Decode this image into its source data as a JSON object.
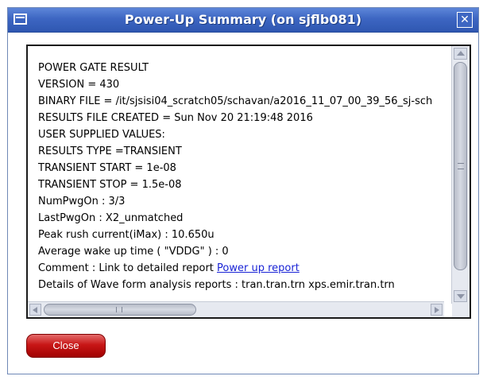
{
  "window": {
    "title": "Power-Up Summary (on sjflb081)",
    "close_glyph": "✕"
  },
  "report": {
    "lines": [
      "POWER GATE RESULT",
      "VERSION = 430",
      "BINARY FILE = /it/sjsisi04_scratch05/schavan/a2016_11_07_00_39_56_sj-sch",
      "RESULTS FILE CREATED = Sun Nov 20 21:19:48 2016",
      "USER SUPPLIED VALUES:",
      "RESULTS TYPE =TRANSIENT",
      "TRANSIENT START = 1e-08",
      "TRANSIENT STOP = 1.5e-08",
      "NumPwgOn : 3/3",
      "LastPwgOn : X2_unmatched",
      "Peak rush current(iMax) : 10.650u",
      "Average wake up time ( \"VDDG\" ) : 0"
    ],
    "comment_prefix": "Comment : Link to detailed report ",
    "comment_link": "Power up report",
    "details": "Details of Wave form analysis reports : tran.tran.trn xps.emir.tran.trn"
  },
  "buttons": {
    "close_label": "Close"
  },
  "colors": {
    "titlebar": "#3d66c2",
    "link": "#1a24d6",
    "close_button": "#c81616"
  },
  "icons": {
    "window_menu": "window-menu-icon",
    "window_close": "close-icon"
  }
}
